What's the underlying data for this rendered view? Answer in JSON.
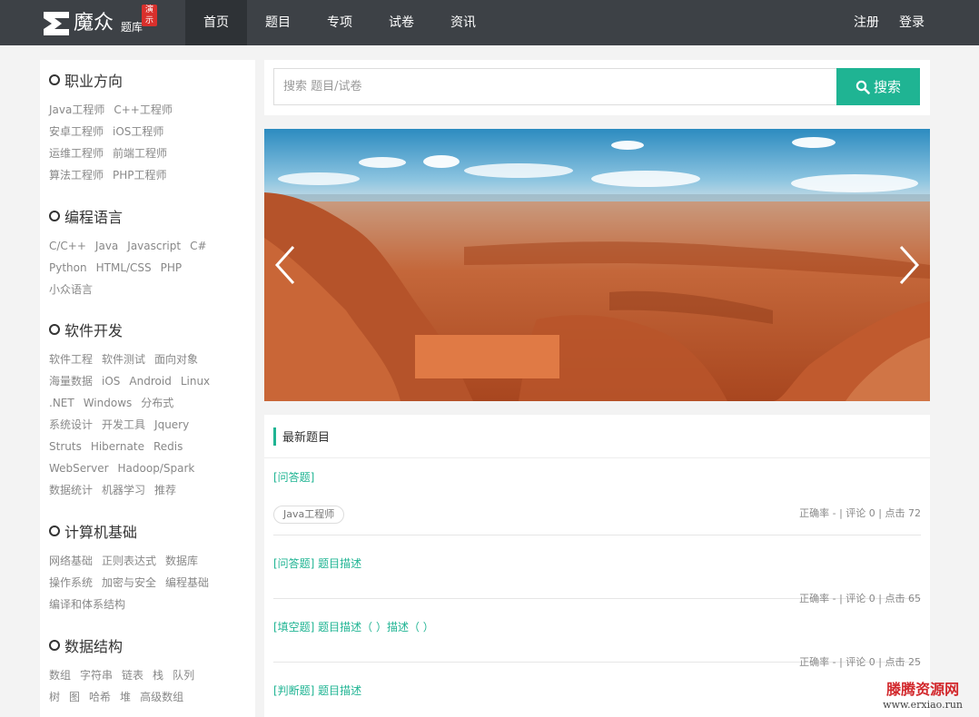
{
  "header": {
    "logo_name": "魔众",
    "logo_sub": "题库",
    "logo_badge": "演示",
    "nav": [
      "首页",
      "题目",
      "专项",
      "试卷",
      "资讯"
    ],
    "register": "注册",
    "login": "登录"
  },
  "sidebar": {
    "categories": [
      {
        "title": "职业方向",
        "tags": [
          "Java工程师",
          "C++工程师",
          "安卓工程师",
          "iOS工程师",
          "运维工程师",
          "前端工程师",
          "算法工程师",
          "PHP工程师"
        ]
      },
      {
        "title": "编程语言",
        "tags": [
          "C/C++",
          "Java",
          "Javascript",
          "C#",
          "Python",
          "HTML/CSS",
          "PHP",
          "小众语言"
        ]
      },
      {
        "title": "软件开发",
        "tags": [
          "软件工程",
          "软件测试",
          "面向对象",
          "海量数据",
          "iOS",
          "Android",
          "Linux",
          ".NET",
          "Windows",
          "分布式",
          "系统设计",
          "开发工具",
          "Jquery",
          "Struts",
          "Hibernate",
          "Redis",
          "WebServer",
          "Hadoop/Spark",
          "数据统计",
          "机器学习",
          "推荐"
        ]
      },
      {
        "title": "计算机基础",
        "tags": [
          "网络基础",
          "正则表达式",
          "数据库",
          "操作系统",
          "加密与安全",
          "编程基础",
          "编译和体系结构"
        ]
      },
      {
        "title": "数据结构",
        "tags": [
          "数组",
          "字符串",
          "链表",
          "栈",
          "队列",
          "树",
          "图",
          "哈希",
          "堆",
          "高级数组"
        ]
      }
    ]
  },
  "search": {
    "placeholder": "搜索 题目/试卷",
    "button": "搜索"
  },
  "latest": {
    "title": "最新题目",
    "items": [
      {
        "title": "[问答题]",
        "tag": "Java工程师",
        "meta": "正确率 - | 评论 0 | 点击 72"
      },
      {
        "title": "[问答题] 题目描述",
        "tag": "",
        "meta": "正确率 - | 评论 0 | 点击 65"
      },
      {
        "title": "[填空题] 题目描述（  ）描述（  ）",
        "tag": "",
        "meta": "正确率 - | 评论 0 | 点击 25"
      },
      {
        "title": "[判断题] 题目描述",
        "tag": "",
        "meta": ""
      }
    ]
  },
  "watermark": {
    "line1": "滕腾资源网",
    "line2": "www.erxiao.run"
  },
  "colors": {
    "accent": "#1fb493",
    "nav_bg": "#3d4146",
    "badge": "#d9302c"
  }
}
